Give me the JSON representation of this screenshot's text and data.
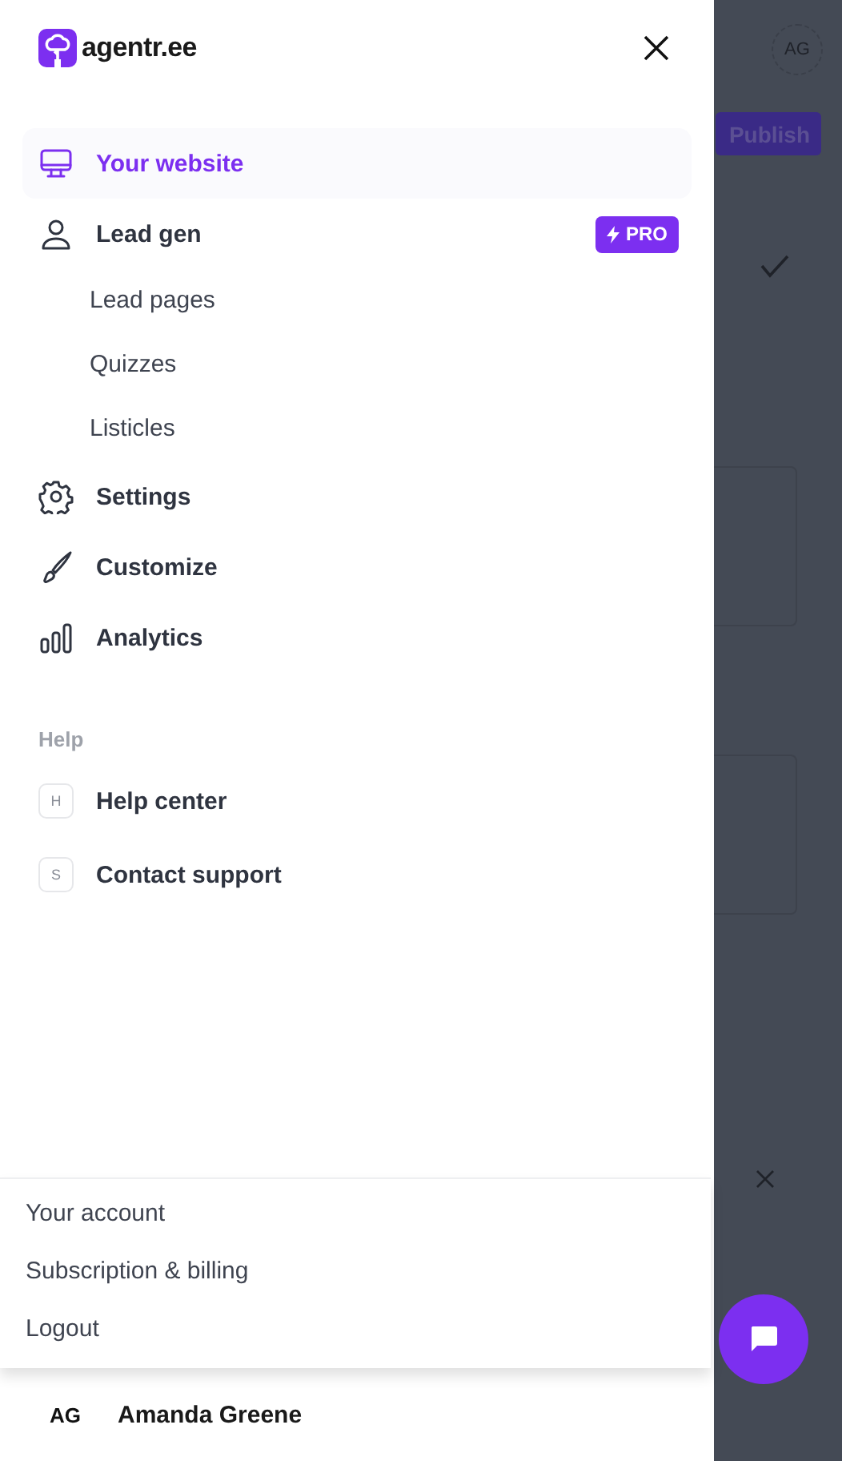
{
  "logo": {
    "text": "agentr.ee"
  },
  "nav": [
    {
      "label": "Your website",
      "kind": "monitor",
      "selected": true
    },
    {
      "label": "Lead gen",
      "kind": "person",
      "selected": false,
      "badge": "PRO",
      "children": [
        {
          "label": "Lead pages"
        },
        {
          "label": "Quizzes"
        },
        {
          "label": "Listicles"
        }
      ]
    },
    {
      "label": "Settings",
      "kind": "gear",
      "selected": false
    },
    {
      "label": "Customize",
      "kind": "brush",
      "selected": false
    },
    {
      "label": "Analytics",
      "kind": "bars",
      "selected": false
    }
  ],
  "help": {
    "title": "Help",
    "items": [
      {
        "key": "H",
        "label": "Help center"
      },
      {
        "key": "S",
        "label": "Contact support"
      }
    ]
  },
  "account_menu": [
    "Your account",
    "Subscription & billing",
    "Logout"
  ],
  "user": {
    "initials": "AG",
    "name": "Amanda Greene"
  },
  "background": {
    "avatar": "AG",
    "publish": "Publish"
  }
}
